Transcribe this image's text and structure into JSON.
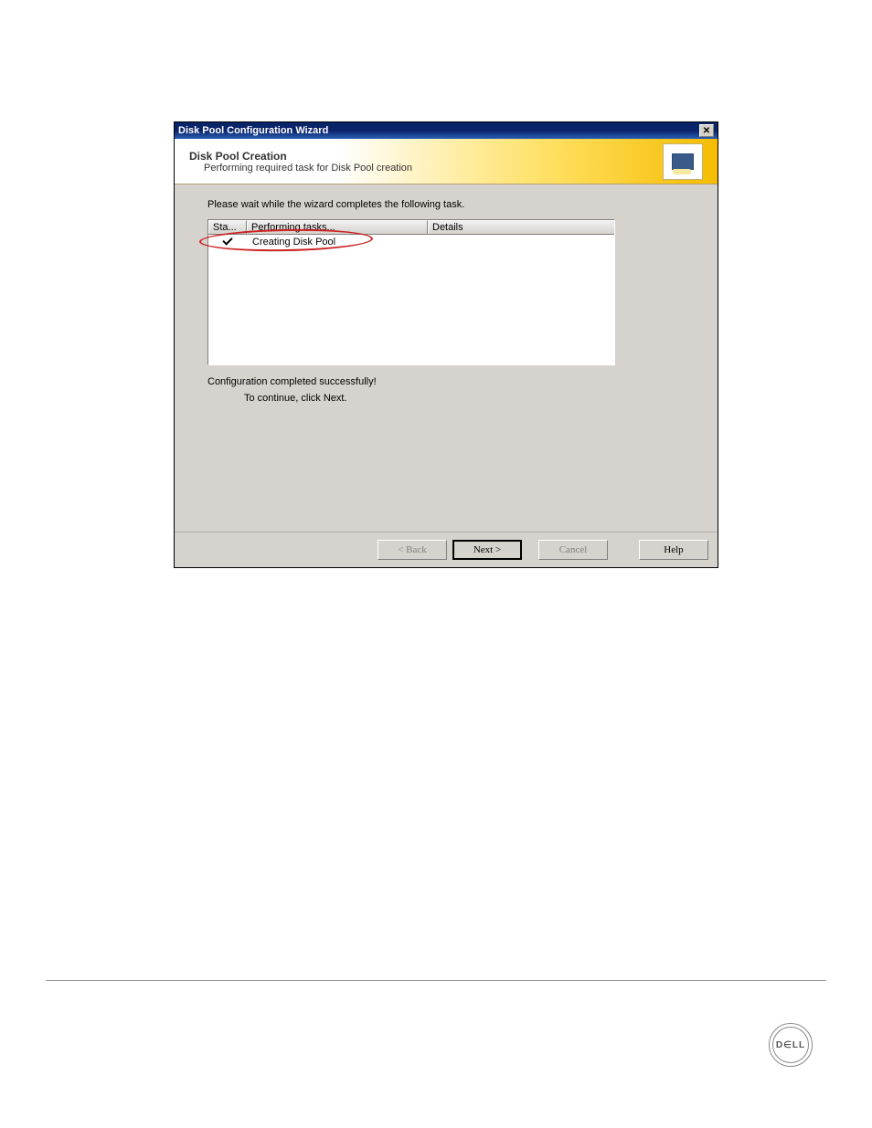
{
  "window": {
    "title": "Disk Pool Configuration Wizard"
  },
  "header": {
    "title": "Disk Pool Creation",
    "subtitle": "Performing required task for Disk Pool creation"
  },
  "content": {
    "instruction": "Please wait while the wizard completes the following task.",
    "table": {
      "columns": {
        "status": "Sta...",
        "tasks": "Performing tasks...",
        "details": "Details"
      },
      "rows": [
        {
          "status": "check",
          "task": "Creating Disk Pool",
          "details": ""
        }
      ]
    },
    "completion_status": "Configuration completed successfully!",
    "continue_hint": "To continue, click Next."
  },
  "buttons": {
    "back": "< Back",
    "next": "Next >",
    "cancel": "Cancel",
    "help": "Help"
  },
  "footer": {
    "logo_text": "D∈LL"
  }
}
